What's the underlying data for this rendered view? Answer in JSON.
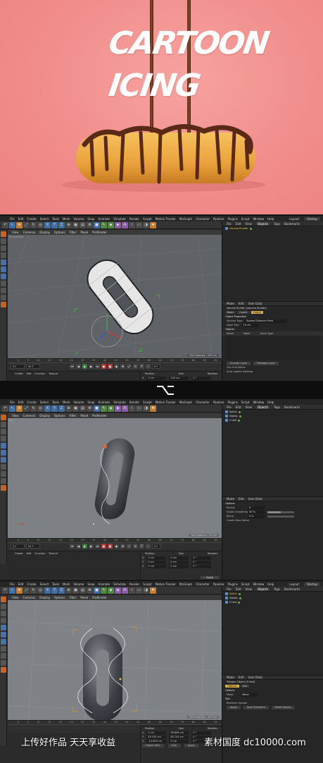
{
  "hero": {
    "title_line1": "CARTOON",
    "title_line2": "ICING"
  },
  "menubar": {
    "items": [
      "File",
      "Edit",
      "Create",
      "Select",
      "Tools",
      "Mesh",
      "Volume",
      "Snap",
      "Animate",
      "Simulate",
      "Render",
      "Sculpt",
      "Motion Tracker",
      "MoGraph",
      "Character",
      "Pipeline",
      "Plugins",
      "Script",
      "Window",
      "Help"
    ],
    "layout_label": "Layout:",
    "layout_value": "Startup"
  },
  "viewport": {
    "menu": [
      "View",
      "Cameras",
      "Display",
      "Options",
      "Filter",
      "Panel",
      "ProRender"
    ],
    "label_persp": "Perspective",
    "label_top": "Top"
  },
  "timeline": {
    "ticks": [
      "0",
      "5",
      "10",
      "15",
      "20",
      "25",
      "30",
      "35",
      "40",
      "45",
      "50",
      "55",
      "60",
      "65",
      "70",
      "75",
      "80",
      "85",
      "90"
    ],
    "field_start": "0 F",
    "field_end": "90 F",
    "frame_right": "0 F"
  },
  "material_manager": {
    "menu": [
      "Create",
      "Edit",
      "Function",
      "Texture"
    ]
  },
  "coords": {
    "headers": [
      "Position",
      "Size",
      "Rotation"
    ],
    "labels": [
      "X",
      "Y",
      "Z"
    ],
    "panel1": {
      "pos": [
        "0 cm",
        "0 cm",
        "0 cm"
      ],
      "size": [
        "100 cm",
        "200 cm",
        "10 cm"
      ],
      "rot": [
        "0 °",
        "0 °",
        "0 °"
      ]
    },
    "panel2": {
      "pos": [
        "0 cm",
        "0 cm",
        "0 cm"
      ],
      "size": [
        "0 cm",
        "0 cm",
        "0 cm"
      ],
      "rot": [
        "0 °",
        "0 °",
        "0 °"
      ]
    },
    "panel3": {
      "pos": [
        "0 cm",
        "56.105 cm",
        "-14.603 cm"
      ],
      "size": [
        "96.666 cm",
        "56.743 cm",
        "0 cm"
      ],
      "rot": [
        "0 °",
        "0 °",
        "0 °"
      ]
    },
    "mode_object": "Object (Rel)",
    "mode_size": "Size",
    "apply": "Apply"
  },
  "object_manager": {
    "menu": [
      "File",
      "Edit",
      "View",
      "Objects",
      "Tags",
      "Bookmarks"
    ],
    "screen1": [
      {
        "name": "Volume Builder",
        "selected": true
      }
    ],
    "screen2": [
      {
        "name": "Spline",
        "selected": false
      },
      {
        "name": "Sweep",
        "selected": false
      },
      {
        "name": "0 text",
        "selected": false
      }
    ],
    "screen3": [
      {
        "name": "Spline",
        "selected": true
      },
      {
        "name": "Sweep",
        "selected": false
      },
      {
        "name": "0 text",
        "selected": false
      }
    ]
  },
  "attribute_manager": {
    "menu": [
      "Mode",
      "Edit",
      "User Data"
    ],
    "s1": {
      "title": "Volume Builder [Volume Builder]",
      "tabs": [
        "Basic",
        "Coord.",
        "Object"
      ],
      "section": "Object Properties",
      "rows": [
        {
          "label": "Volume Type",
          "value": "Signed Distance Field"
        },
        {
          "label": "Voxel Size",
          "value": "10 cm"
        }
      ],
      "objects_label": "Objects",
      "cols": [
        "Name",
        "Mode",
        "Input Type"
      ],
      "footer_btns": [
        "Smooth Layer",
        "Reshape Layer"
      ],
      "opt1": "Use Grid Matrix",
      "opt2": "Auto Update Settings"
    },
    "s2": {
      "section": "Options",
      "rows": [
        {
          "label": "Radius",
          "value": "0"
        },
        {
          "label": "Stroke Smoothing",
          "value": "50 %"
        },
        {
          "label": "Blend",
          "value": "0 %"
        }
      ],
      "create_spline": "Create New Spline"
    },
    "s3": {
      "title": "Polygon Object [0 text]",
      "tabs": [
        "Options",
        "Tool"
      ],
      "section": "Options",
      "mode_label": "Mode",
      "mode_value": "Wave",
      "tool_label": "Tool",
      "realtime": "Realtime Update",
      "buttons": [
        "Apply",
        "New Transform",
        "Reset Values"
      ]
    }
  },
  "grid_spacing": {
    "s1": "Grid Spacing : 100 cm",
    "s2": "Grid Spacing : 50 cm",
    "s3": "Grid Spacing : 100 cm"
  },
  "watermark": {
    "left": "上传好作品  天天享收益",
    "right": "素材国度  dc10000.com"
  },
  "colors": {
    "hero_bg": "#f08c8a",
    "accent_selected": "#d9b04a",
    "viewport_gray": "#7d8186"
  }
}
